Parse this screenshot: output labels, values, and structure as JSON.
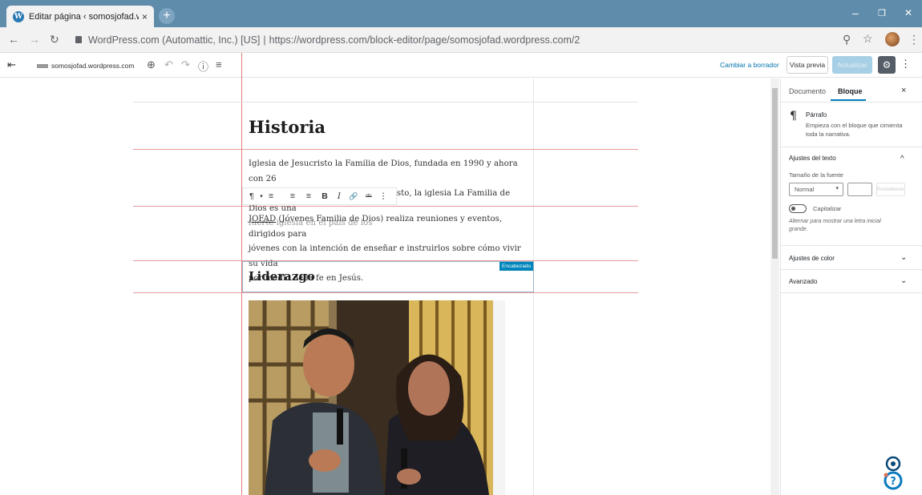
{
  "browser": {
    "tab_title": "Editar página ‹ somosjofad.word",
    "tab_close": "×",
    "new_tab": "+",
    "url_org": "WordPress.com (Automattic, Inc.) [US]",
    "url_sep": "|",
    "url_path": "https://wordpress.com/block-editor/page/somosjofad.wordpress.com/2",
    "window_controls": [
      "–",
      "❐",
      "✕"
    ]
  },
  "editor_header": {
    "back": "⇤",
    "site_name": "somosjofad.wordpress.com",
    "tools": [
      "⊕",
      "↶",
      "↷",
      "ⓘ",
      "≡"
    ],
    "switch_draft": "Cambiar a borrador",
    "preview": "Vista previa",
    "update": "Actualizar",
    "settings": "⚙",
    "more": "⋮"
  },
  "content": {
    "heading1": "Historia",
    "para1_line1": "Iglesia de Jesucristo la Familia de Dios, fundada en 1990 y ahora con 26",
    "para1_line2": "años por la gracia del Señor Jesucristo, la iglesia La Familia de Dios es una",
    "para1_line3": "fuerte iglesia en el país de los",
    "para2_link": "JOFAD",
    "para2_rest": " (Jóvenes Familia de Dios) realiza reuniones y eventos, dirigidos para",
    "para2_line2": "jóvenes con la intención de enseñar e instruirlos sobre cómo vivir su vida",
    "para2_line3": "por medio de la fe en Jesús.",
    "heading2": "Liderazgo",
    "heading2_badge": "Encabezado"
  },
  "block_toolbar": {
    "items": [
      "¶",
      "▾",
      "≡",
      "≡",
      "≡",
      "B",
      "I",
      "🔗",
      "ᵃᵇᶜ",
      "⋮"
    ]
  },
  "sidebar": {
    "tab_document": "Documento",
    "tab_block": "Bloque",
    "close": "×",
    "block_icon": "¶",
    "block_name": "Párrafo",
    "block_desc": "Empieza con el bloque que cimienta toda la narrativa.",
    "text_settings": "Ajustes del texto",
    "font_size_label": "Tamaño de la fuente",
    "font_size_value": "Normal",
    "reset": "Restablecer",
    "dropcap_label": "Capitalizar",
    "dropcap_help": "Alternar para mostrar una letra inicial grande.",
    "color_settings": "Ajustes de color",
    "advanced": "Avanzado",
    "caret_up": "^",
    "caret_down": "⌄"
  },
  "colors": {
    "chrome_blue": "#5f8cab",
    "wp_blue": "#0073aa",
    "guide_red": "#e07a7a",
    "badge_blue": "#0085ba"
  }
}
